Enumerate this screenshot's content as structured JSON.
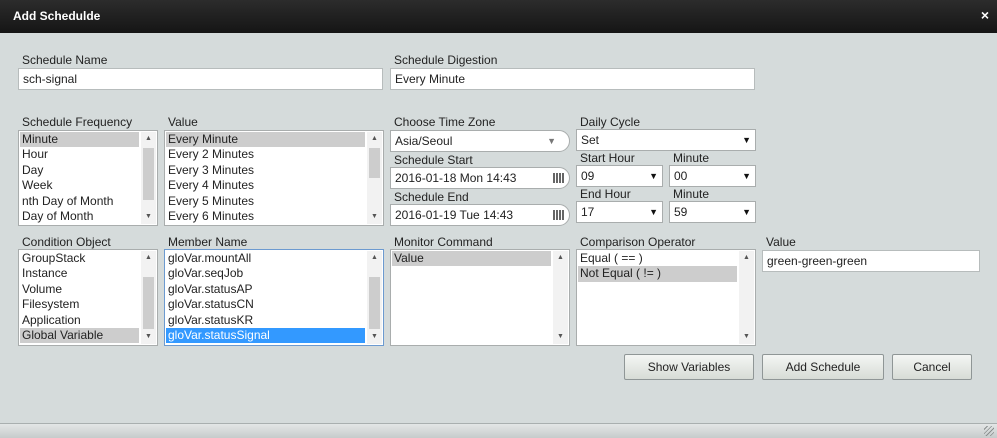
{
  "dialog": {
    "title": "Add Schedulde",
    "close_glyph": "×"
  },
  "schedule_name": {
    "label": "Schedule Name",
    "value": "sch-signal"
  },
  "schedule_digestion": {
    "label": "Schedule Digestion",
    "value": "Every Minute"
  },
  "frequency": {
    "label": "Schedule Frequency",
    "items": [
      "Minute",
      "Hour",
      "Day",
      "Week",
      "nth Day of Month",
      "Day of Month"
    ],
    "selected": "Minute"
  },
  "value_list": {
    "label": "Value",
    "items": [
      "Every Minute",
      "Every 2 Minutes",
      "Every 3 Minutes",
      "Every 4 Minutes",
      "Every 5 Minutes",
      "Every 6 Minutes"
    ],
    "selected": "Every Minute"
  },
  "time_zone": {
    "label": "Choose Time Zone",
    "value": "Asia/Seoul"
  },
  "schedule_start": {
    "label": "Schedule Start",
    "value": "2016-01-18 Mon 14:43"
  },
  "schedule_end": {
    "label": "Schedule End",
    "value": "2016-01-19 Tue 14:43"
  },
  "daily_cycle": {
    "label": "Daily Cycle",
    "value": "Set"
  },
  "start_hour": {
    "label": "Start Hour",
    "value": "09"
  },
  "start_minute": {
    "label": "Minute",
    "value": "00"
  },
  "end_hour": {
    "label": "End Hour",
    "value": "17"
  },
  "end_minute": {
    "label": "Minute",
    "value": "59"
  },
  "condition_object": {
    "label": "Condition Object",
    "items": [
      "GroupStack",
      "Instance",
      "Volume",
      "Filesystem",
      "Application",
      "Global Variable"
    ],
    "selected": "Global Variable"
  },
  "member_name": {
    "label": "Member Name",
    "items": [
      "gloVar.mountAll",
      "gloVar.seqJob",
      "gloVar.statusAP",
      "gloVar.statusCN",
      "gloVar.statusKR",
      "gloVar.statusSignal"
    ],
    "selected": "gloVar.statusSignal"
  },
  "monitor_command": {
    "label": "Monitor Command",
    "items": [
      "Value"
    ],
    "selected": "Value"
  },
  "comparison_operator": {
    "label": "Comparison Operator",
    "items": [
      "Equal ( == )",
      "Not Equal ( != )"
    ],
    "selected": "Not Equal ( != )"
  },
  "compare_value": {
    "label": "Value",
    "value": "green-green-green"
  },
  "buttons": {
    "show_variables": "Show Variables",
    "add_schedule": "Add Schedule",
    "cancel": "Cancel"
  },
  "colors": {
    "title_bg": "#1e1e1e",
    "panel_bg": "#d5dbdb",
    "list_highlight": "#3399ff",
    "list_selected_gray": "#cdcdcd"
  }
}
